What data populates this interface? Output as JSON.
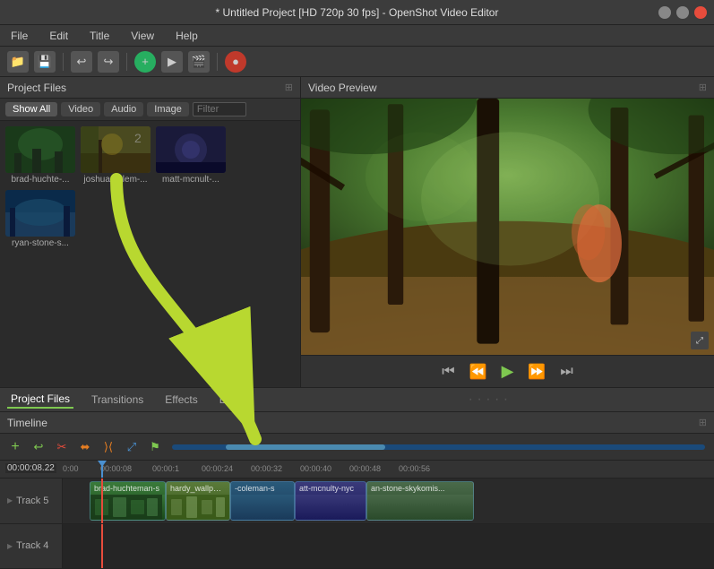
{
  "app": {
    "title": "* Untitled Project [HD 720p 30 fps] - OpenShot Video Editor"
  },
  "window": {
    "minimize_label": "—",
    "maximize_label": "□",
    "close_label": "✕"
  },
  "menu": {
    "items": [
      "File",
      "Edit",
      "Title",
      "View",
      "Help"
    ]
  },
  "toolbar": {
    "buttons": [
      "folder",
      "save",
      "undo",
      "redo",
      "plus",
      "play-small",
      "clip",
      "record"
    ]
  },
  "project_files": {
    "header": "Project Files",
    "tabs": [
      "Show All",
      "Video",
      "Audio",
      "Image",
      "Filter"
    ],
    "files": [
      {
        "label": "brad-huchte-...",
        "thumb_class": "thumb-brad"
      },
      {
        "label": "joshua-colem-...",
        "thumb_class": "thumb-joshua"
      },
      {
        "label": "matt-mcnult-...",
        "thumb_class": "thumb-matt"
      },
      {
        "label": "ryan-stone-s...",
        "thumb_class": "thumb-ryan"
      }
    ]
  },
  "video_preview": {
    "header": "Video Preview"
  },
  "preview_controls": {
    "skip_back": "⏮",
    "rewind": "⏪",
    "play": "▶",
    "fast_forward": "⏩",
    "skip_forward": "⏭"
  },
  "bottom_tabs": {
    "tabs": [
      "Project Files",
      "Transitions",
      "Effects",
      "Emojis"
    ]
  },
  "timeline": {
    "header": "Timeline",
    "timecode": "00:00:08.22",
    "ruler_times": [
      "0:00",
      "00:00:08",
      "00:00:1",
      "00:00:24",
      "00:00:32",
      "00:00:40",
      "00:00:48",
      "00:00:56"
    ],
    "tracks": [
      {
        "label": "Track 5",
        "clips": [
          {
            "label": "brad-huchteman-s",
            "class": "clip-brad"
          },
          {
            "label": "hardy_wallpaper_",
            "class": "clip-hardy"
          },
          {
            "label": "-coleman-s",
            "class": "clip-coleman"
          },
          {
            "label": "att-mcnulty-nyc",
            "class": "clip-matt"
          },
          {
            "label": "an-stone-skykomis...",
            "class": "clip-ryan"
          }
        ]
      },
      {
        "label": "Track 4",
        "clips": []
      }
    ]
  }
}
